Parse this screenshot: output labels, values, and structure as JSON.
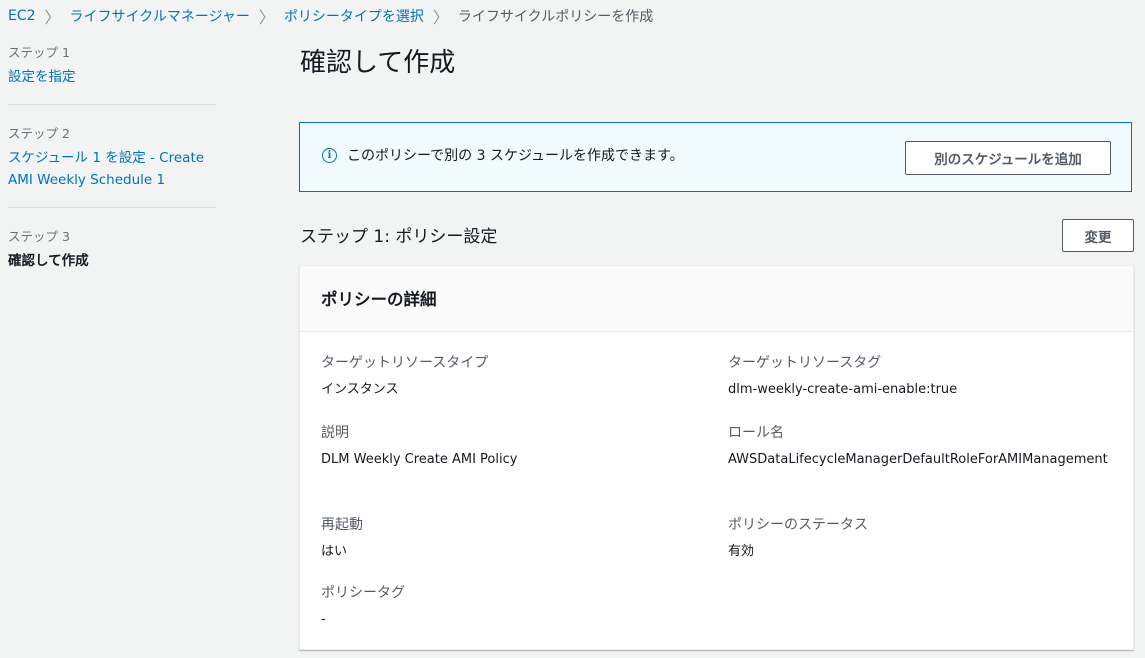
{
  "breadcrumb": {
    "items": [
      "EC2",
      "ライフサイクルマネージャー",
      "ポリシータイプを選択"
    ],
    "current": "ライフサイクルポリシーを作成"
  },
  "steps": [
    {
      "number": "ステップ 1",
      "title": "設定を指定"
    },
    {
      "number": "ステップ 2",
      "title": "スケジュール 1 を設定 - Create AMI Weekly Schedule 1"
    },
    {
      "number": "ステップ 3",
      "title": "確認して作成"
    }
  ],
  "page_title": "確認して作成",
  "info": {
    "icon": "info-icon",
    "text": "このポリシーで別の 3 スケジュールを作成できます。",
    "button": "別のスケジュールを追加"
  },
  "section": {
    "title": "ステップ 1: ポリシー設定",
    "edit_button": "変更"
  },
  "card": {
    "title": "ポリシーの詳細",
    "fields": {
      "target_resource_type": {
        "label": "ターゲットリソースタイプ",
        "value": "インスタンス"
      },
      "target_resource_tag": {
        "label": "ターゲットリソースタグ",
        "value": "dlm-weekly-create-ami-enable:true"
      },
      "description": {
        "label": "説明",
        "value": "DLM Weekly Create AMI Policy"
      },
      "role_name": {
        "label": "ロール名",
        "value": "AWSDataLifecycleManagerDefaultRoleForAMIManagement"
      },
      "reboot": {
        "label": "再起動",
        "value": "はい"
      },
      "policy_status": {
        "label": "ポリシーのステータス",
        "value": "有効"
      },
      "policy_tags": {
        "label": "ポリシータグ",
        "value": "-"
      }
    }
  },
  "colors": {
    "link": "#0073bb",
    "background": "#f2f3f3",
    "info_bg": "#f1faff"
  }
}
